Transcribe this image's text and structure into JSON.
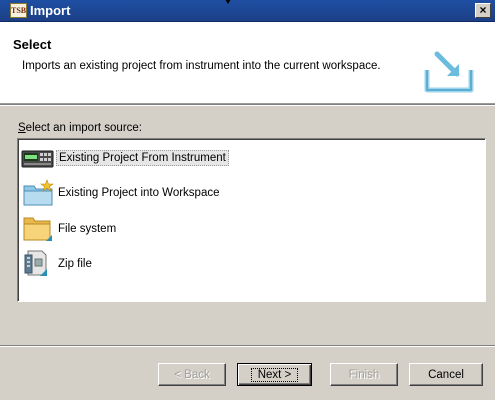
{
  "window": {
    "title": "Import",
    "app_icon_text": "TSB",
    "close_glyph": "×"
  },
  "header": {
    "title": "Select",
    "description": "Imports an existing project from instrument into the current workspace.",
    "icon": "import-wizard-icon"
  },
  "source_section": {
    "label_prefix": "S",
    "label_rest": "elect an import source:"
  },
  "sources": [
    {
      "label": "Existing Project From Instrument",
      "icon": "instrument-icon",
      "selected": true
    },
    {
      "label": "Existing Project into Workspace",
      "icon": "project-folder-icon",
      "selected": false
    },
    {
      "label": "File system",
      "icon": "folder-icon",
      "selected": false
    },
    {
      "label": "Zip file",
      "icon": "zip-file-icon",
      "selected": false
    }
  ],
  "buttons": {
    "back": "< Back",
    "next": "Next >",
    "finish": "Finish",
    "cancel": "Cancel"
  },
  "colors": {
    "titlebar": "#1e4fa3",
    "dialog_bg": "#d4d0c8",
    "icon_teal": "#2a8fb5"
  }
}
